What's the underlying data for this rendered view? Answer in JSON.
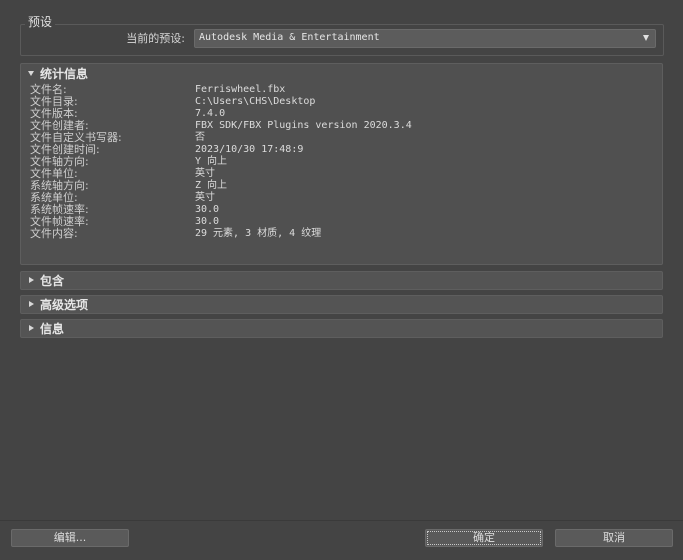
{
  "preset": {
    "legend": "预设",
    "label": "当前的预设:",
    "value": "Autodesk Media & Entertainment"
  },
  "stats": {
    "title": "统计信息",
    "rows": [
      {
        "label": "文件名:",
        "value": "Ferriswheel.fbx"
      },
      {
        "label": "文件目录:",
        "value": "C:\\Users\\CHS\\Desktop"
      },
      {
        "label": "文件版本:",
        "value": "7.4.0"
      },
      {
        "label": "文件创建者:",
        "value": "FBX SDK/FBX Plugins version 2020.3.4"
      },
      {
        "label": "文件自定义书写器:",
        "value": "否"
      },
      {
        "label": "文件创建时间:",
        "value": "2023/10/30  17:48:9"
      },
      {
        "label": "文件轴方向:",
        "value": "Y 向上"
      },
      {
        "label": "文件单位:",
        "value": "英寸"
      },
      {
        "label": "系统轴方向:",
        "value": "Z 向上"
      },
      {
        "label": "系统单位:",
        "value": "英寸"
      },
      {
        "label": "系统帧速率:",
        "value": "30.0"
      },
      {
        "label": "文件帧速率:",
        "value": "30.0"
      },
      {
        "label": "文件内容:",
        "value": "29 元素,   3 材质,   4 纹理"
      }
    ]
  },
  "rollouts": {
    "include": "包含",
    "advanced": "高级选项",
    "info": "信息"
  },
  "footer": {
    "edit": "编辑...",
    "ok": "确定",
    "cancel": "取消"
  }
}
